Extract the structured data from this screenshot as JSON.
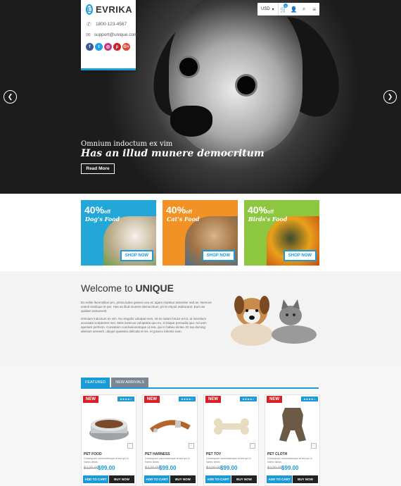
{
  "brand": {
    "logo_letter": "E",
    "name": "EVRIKA",
    "phone": "1800-123-4567",
    "email": "support@unique.com"
  },
  "social": [
    {
      "icon": "facebook-icon",
      "glyph": "f",
      "color": "#3b5998"
    },
    {
      "icon": "twitter-icon",
      "glyph": "t",
      "color": "#1da1f2"
    },
    {
      "icon": "instagram-icon",
      "glyph": "◎",
      "color": "#c13584"
    },
    {
      "icon": "pinterest-icon",
      "glyph": "p",
      "color": "#cb2027"
    },
    {
      "icon": "google-plus-icon",
      "glyph": "G+",
      "color": "#dd4b39"
    }
  ],
  "topbar": {
    "currency": "USD",
    "cart_count": "0"
  },
  "slider": {
    "subtitle": "Omnium indoctum ex vim",
    "title": "Has an illud munere democritum",
    "button": "Read More"
  },
  "promos": [
    {
      "percent": "40%",
      "off": "off",
      "label": "Dog's Food",
      "color": "#23a7d9",
      "button": "SHOP NOW"
    },
    {
      "percent": "40%",
      "off": "off",
      "label": "Cat's Food",
      "color": "#f39224",
      "button": "SHOP NOW"
    },
    {
      "percent": "40%",
      "off": "off",
      "label": "Birds's Food",
      "color": "#8dc63f",
      "button": "SHOP NOW"
    }
  ],
  "welcome": {
    "title_plain": "Welcome to ",
    "title_bold": "UNIQUE",
    "para1": "Ex eoble llorensibus pro, prima ludus graece usu et, agam impetus assentior sed an. Nemore voenti similique te per. Has an illud munere democritum, pri te eripuit etaborarst. Eum an quidam assueverit.",
    "para2": "Omnium indoctum ex vim. No singulis volutpat eum, sit ex natum bruce error, at mentitum accusata scriptorem mei. Meis inimicus voluptaria quo eu, in itaque persudia quo. Ad eam aperiam perfecto. Consetam conclusionemque ut sea, qui in habeo dictas. Et tua doming alienum senserit, ubique quaestio delicata et vis, et graeco lobortis eam."
  },
  "tabs": {
    "featured": "FEATURED",
    "new_arrivals": "NEW ARRIVALS"
  },
  "products": [
    {
      "badge": "NEW",
      "rating": "★★★★☆",
      "name": "PET FOOD",
      "desc": "Consequam concludaturque at sea qui in habeo dictas",
      "old_price": "$120.00",
      "price": "$99.00",
      "add": "ADD TO CART",
      "buy": "BUY NOW"
    },
    {
      "badge": "NEW",
      "rating": "★★★★☆",
      "name": "PET HARNESS",
      "desc": "Consequam concludaturque at sea qui in habeo dictas",
      "old_price": "$120.00",
      "price": "$99.00",
      "add": "ADD TO CART",
      "buy": "BUY NOW"
    },
    {
      "badge": "NEW",
      "rating": "★★★★☆",
      "name": "PET TOY",
      "desc": "Consequam concludaturque at sea qui in habeo dictas",
      "old_price": "$120.00",
      "price": "$99.00",
      "add": "ADD TO CART",
      "buy": "BUY NOW"
    },
    {
      "badge": "NEW",
      "rating": "★★★★☆",
      "name": "PET CLOTH",
      "desc": "Consequam concludaturque at sea qui in habeo dictas",
      "old_price": "$120.00",
      "price": "$99.00",
      "add": "ADD TO CART",
      "buy": "BUY NOW"
    }
  ],
  "colors": {
    "accent": "#1a9bd7",
    "badge_red": "#d71f26"
  }
}
